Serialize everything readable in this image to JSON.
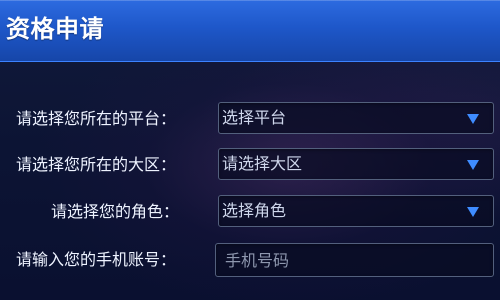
{
  "header": {
    "title": "资格申请"
  },
  "form": {
    "platform": {
      "label": "请选择您所在的平台：",
      "value": "选择平台",
      "icon": "chevron-down-icon"
    },
    "region": {
      "label": "请选择您所在的大区：",
      "value": "请选择大区",
      "icon": "chevron-down-icon"
    },
    "character": {
      "label": "请选择您的角色：",
      "value": "选择角色",
      "icon": "chevron-down-icon"
    },
    "phone": {
      "label": "请输入您的手机账号：",
      "placeholder": "手机号码",
      "value": ""
    }
  },
  "colors": {
    "header_blue": "#1e57c9",
    "page_navy": "#0c1434",
    "accent_blue": "#3f8cff",
    "text": "#eef3ff"
  }
}
